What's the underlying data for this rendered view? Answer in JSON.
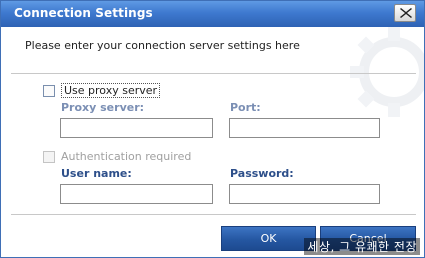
{
  "window": {
    "title": "Connection Settings"
  },
  "prompt": "Please enter your connection server settings here",
  "proxy": {
    "use_proxy_label": "Use proxy server",
    "server_label": "Proxy server:",
    "server_value": "",
    "port_label": "Port:",
    "port_value": ""
  },
  "auth": {
    "required_label": "Authentication required",
    "username_label": "User name:",
    "username_value": "",
    "password_label": "Password:",
    "password_value": ""
  },
  "buttons": {
    "ok": "OK",
    "cancel": "Cancel"
  },
  "watermark": "세상, 그 유쾌한 전장",
  "icons": [
    "close-icon",
    "gear-icon"
  ],
  "colors": {
    "titlebar": "#3e79cf",
    "button": "#2557a2",
    "label_muted": "#7b8fb4",
    "label_dark": "#2d4f8a"
  }
}
